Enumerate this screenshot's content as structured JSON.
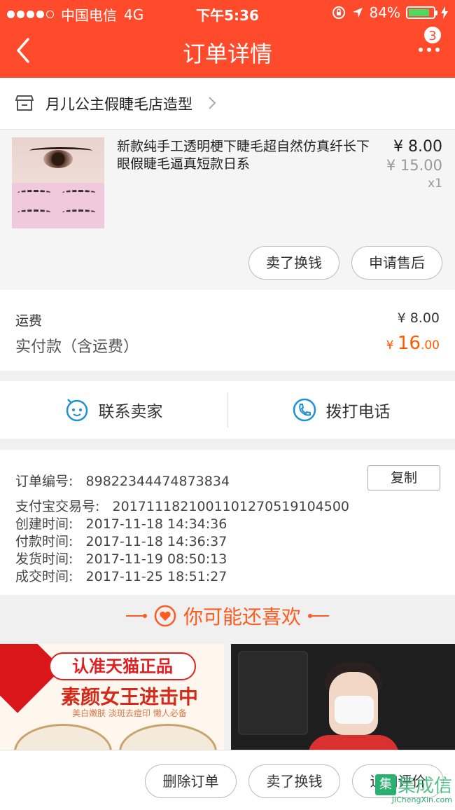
{
  "status_bar": {
    "carrier": "中国电信",
    "network": "4G",
    "time": "下午5:36",
    "battery": "84%",
    "battery_level": 0.84
  },
  "nav": {
    "title": "订单详情",
    "badge": "3"
  },
  "shop": {
    "name": "月儿公主假睫毛店造型"
  },
  "product": {
    "title": "新款纯手工透明梗下睫毛超自然仿真纤长下眼假睫毛逼真短款日系",
    "price": "¥ 8.00",
    "original_price": "¥ 15.00",
    "quantity": "x1",
    "sell_button": "卖了换钱",
    "aftersale_button": "申请售后"
  },
  "fees": {
    "shipping_label": "运费",
    "shipping_value": "¥ 8.00",
    "paid_label": "实付款（含运费）",
    "paid_currency": "¥",
    "paid_integer": "16",
    "paid_decimal": ".00"
  },
  "contact": {
    "seller": "联系卖家",
    "phone": "拨打电话"
  },
  "order_info": {
    "order_no_label": "订单编号:",
    "order_no": "89822344474873834",
    "copy_button": "复制",
    "alipay_label": "支付宝交易号:",
    "alipay_no": "2017111821001101270519104500",
    "created_label": "创建时间:",
    "created": "2017-11-18 14:34:36",
    "paid_label": "付款时间:",
    "paid": "2017-11-18 14:36:37",
    "shipped_label": "发货时间:",
    "shipped": "2017-11-19 08:50:13",
    "completed_label": "成交时间:",
    "completed": "2017-11-25 18:51:27"
  },
  "recommend": {
    "title": "你可能还喜欢",
    "card1_line1": "认准天猫正品",
    "card1_line2": "素颜女王进击中",
    "card1_sub": "美白嫩肤 淡斑去痘印 懒人必备"
  },
  "bottom_bar": {
    "delete_button": "删除订单",
    "sell_button": "卖了换钱",
    "review_button": "追加评价"
  },
  "watermark": {
    "text": "集成信",
    "url": "JiChengXin.com"
  },
  "colors": {
    "brand": "#ff4b2b",
    "accent_orange": "#ff5a00",
    "link_blue": "#1e90d6"
  }
}
